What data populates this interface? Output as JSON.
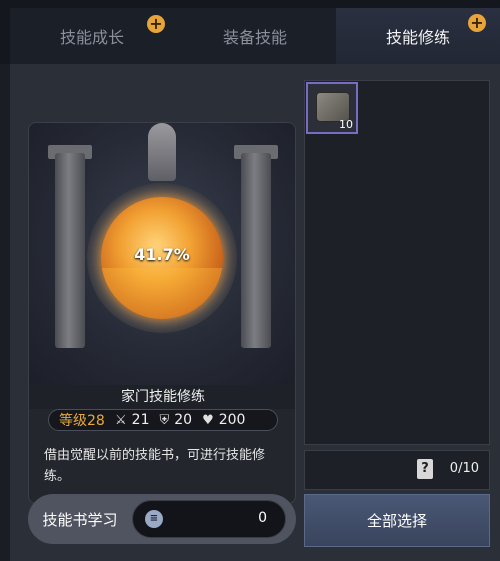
{
  "tabs": [
    {
      "label": "技能成长",
      "has_plus": true,
      "active": false
    },
    {
      "label": "装备技能",
      "has_plus": false,
      "active": false
    },
    {
      "label": "技能修练",
      "has_plus": true,
      "active": true
    }
  ],
  "training": {
    "progress_text": "41.7%",
    "progress_fraction": 0.417,
    "name": "家门技能修练",
    "level_label": "等级28",
    "attack": "21",
    "defense": "20",
    "hp": "200",
    "description": "借由觉醒以前的技能书，可进行技能修练。"
  },
  "inventory": {
    "slot_count": "10",
    "selected_count": "0/10"
  },
  "buttons": {
    "select_all": "全部选择",
    "skill_book_learn": "技能书学习",
    "learn_value": "0"
  },
  "colors": {
    "accent_gold": "#e7a43a",
    "selected_border": "#7a6cc4",
    "primary_button": "#4a5876"
  },
  "icons": {
    "plus": "plus-icon",
    "attack": "crossed-swords-icon",
    "defense": "shield-icon",
    "hp": "heart-icon",
    "book": "skill-book-icon",
    "help": "question-book-icon"
  }
}
